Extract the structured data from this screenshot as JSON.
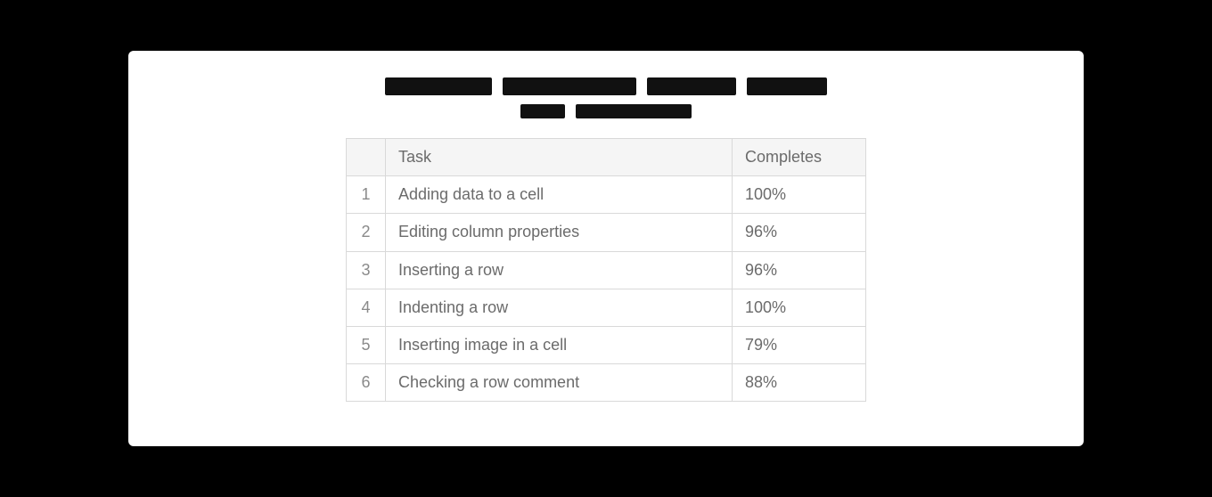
{
  "headers": {
    "index": "",
    "task": "Task",
    "completes": "Completes"
  },
  "rows": [
    {
      "n": "1",
      "task": "Adding data to a cell",
      "completes": "100%"
    },
    {
      "n": "2",
      "task": "Editing column properties",
      "completes": "96%"
    },
    {
      "n": "3",
      "task": "Inserting a row",
      "completes": "96%"
    },
    {
      "n": "4",
      "task": "Indenting a row",
      "completes": "100%"
    },
    {
      "n": "5",
      "task": "Inserting image in a cell",
      "completes": "79%"
    },
    {
      "n": "6",
      "task": "Checking a row comment",
      "completes": "88%"
    }
  ],
  "chart_data": {
    "type": "table",
    "title": "",
    "columns": [
      "Task",
      "Completes"
    ],
    "data": [
      [
        "Adding data to a cell",
        100
      ],
      [
        "Editing column properties",
        96
      ],
      [
        "Inserting a row",
        96
      ],
      [
        "Indenting a row",
        100
      ],
      [
        "Inserting image in a cell",
        79
      ],
      [
        "Checking a row comment",
        88
      ]
    ],
    "units": {
      "Completes": "%"
    }
  }
}
